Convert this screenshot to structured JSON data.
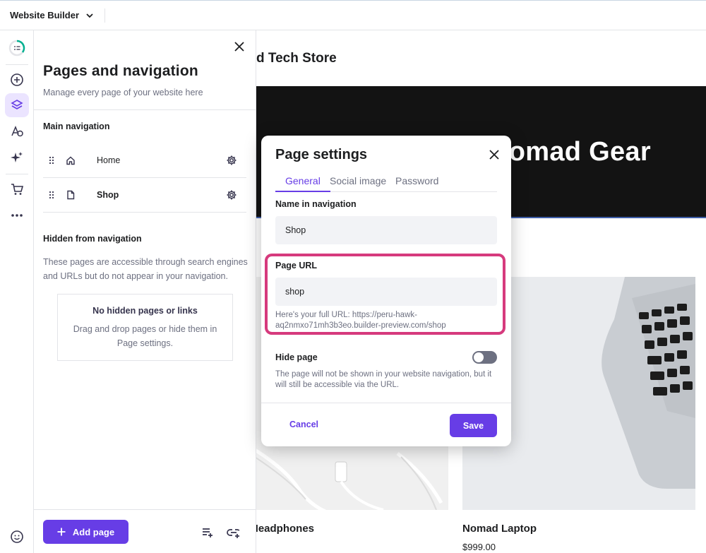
{
  "topbar": {
    "title": "Website Builder"
  },
  "panel": {
    "title": "Pages and navigation",
    "subtitle": "Manage every page of your website here",
    "main_nav_heading": "Main navigation",
    "main_nav_items": [
      {
        "label": "Home",
        "icon": "home-icon"
      },
      {
        "label": "Shop",
        "icon": "page-icon"
      }
    ],
    "hidden_heading": "Hidden from navigation",
    "hidden_description": "These pages are accessible through search engines and URLs but do not appear in your navigation.",
    "empty_title": "No hidden pages or links",
    "empty_description": "Drag and drop pages or hide them in Page settings.",
    "add_page_label": "Add page"
  },
  "canvas": {
    "store_name": "d Tech Store",
    "hero_title": "Nomad Gear",
    "products": [
      {
        "name": "Headphones",
        "price": ""
      },
      {
        "name": "Nomad Laptop",
        "price": "$999.00"
      }
    ]
  },
  "modal": {
    "title": "Page settings",
    "tabs": [
      "General",
      "Social image",
      "Password"
    ],
    "active_tab": "General",
    "name_label": "Name in navigation",
    "name_value": "Shop",
    "url_label": "Page URL",
    "url_value": "shop",
    "url_help": "Here's your full URL: https://peru-hawk-aq2nmxo71mh3b3eo.builder-preview.com/shop",
    "hide_label": "Hide page",
    "hide_enabled": false,
    "hide_description": "The page will not be shown in your website navigation, but it will still be accessible via the URL.",
    "cancel_label": "Cancel",
    "save_label": "Save"
  },
  "colors": {
    "accent": "#673de6",
    "highlight": "#d63a7d",
    "hero_bg": "#131313"
  }
}
